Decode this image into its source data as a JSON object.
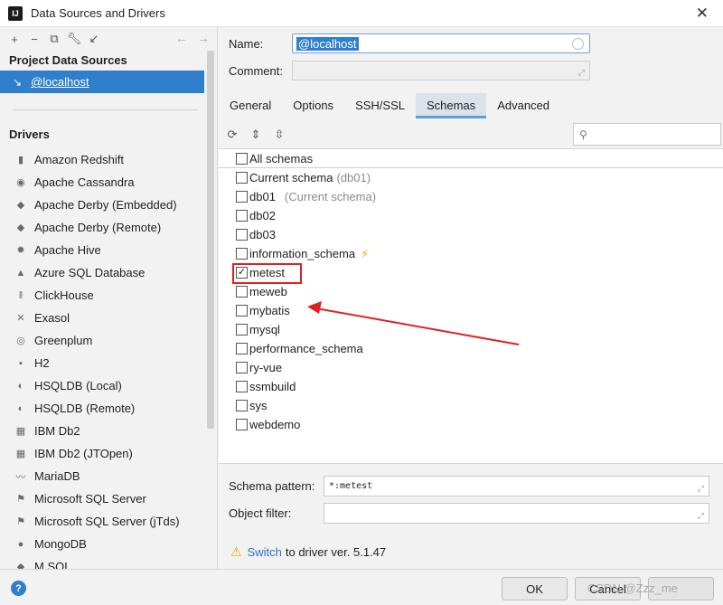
{
  "window": {
    "title": "Data Sources and Drivers",
    "logo": "IJ"
  },
  "left": {
    "toolbar": {
      "icons": [
        "add-icon",
        "remove-icon",
        "copy-icon",
        "wrench-icon",
        "import-icon"
      ],
      "nav": [
        "←",
        "→"
      ]
    },
    "project_header": "Project Data Sources",
    "selected_source": "@localhost",
    "drivers_header": "Drivers",
    "drivers": [
      "Amazon Redshift",
      "Apache Cassandra",
      "Apache Derby (Embedded)",
      "Apache Derby (Remote)",
      "Apache Hive",
      "Azure SQL Database",
      "ClickHouse",
      "Exasol",
      "Greenplum",
      "H2",
      "HSQLDB (Local)",
      "HSQLDB (Remote)",
      "IBM Db2",
      "IBM Db2 (JTOpen)",
      "MariaDB",
      "Microsoft SQL Server",
      "Microsoft SQL Server (jTds)",
      "MongoDB",
      "M SQL"
    ]
  },
  "form": {
    "name_label": "Name:",
    "name_value": "@localhost",
    "comment_label": "Comment:"
  },
  "tabs": [
    "General",
    "Options",
    "SSH/SSL",
    "Schemas",
    "Advanced"
  ],
  "schemas": {
    "all": "All schemas",
    "current": {
      "label": "Current schema",
      "hint": "(db01)"
    },
    "items": [
      {
        "name": "db01",
        "hint": "(Current schema)",
        "checked": false
      },
      {
        "name": "db02",
        "hint": "",
        "checked": false
      },
      {
        "name": "db03",
        "hint": "",
        "checked": false
      },
      {
        "name": "information_schema",
        "hint": "",
        "checked": false,
        "bolt": true
      },
      {
        "name": "metest",
        "hint": "",
        "checked": true
      },
      {
        "name": "meweb",
        "hint": "",
        "checked": false
      },
      {
        "name": "mybatis",
        "hint": "",
        "checked": false
      },
      {
        "name": "mysql",
        "hint": "",
        "checked": false
      },
      {
        "name": "performance_schema",
        "hint": "",
        "checked": false
      },
      {
        "name": "ry-vue",
        "hint": "",
        "checked": false
      },
      {
        "name": "ssmbuild",
        "hint": "",
        "checked": false
      },
      {
        "name": "sys",
        "hint": "",
        "checked": false
      },
      {
        "name": "webdemo",
        "hint": "",
        "checked": false
      }
    ]
  },
  "pattern": {
    "schema_label": "Schema pattern:",
    "schema_value": "*:metest",
    "filter_label": "Object filter:"
  },
  "warning": {
    "link": "Switch",
    "text": "to driver ver. 5.1.47"
  },
  "buttons": {
    "ok": "OK",
    "cancel": "Cancel",
    "help": "?"
  },
  "watermark": "CSDN @Zzz_me",
  "colors": {
    "accent": "#2f7fcc",
    "highlight": "#e02020",
    "warning": "#e6a600"
  }
}
